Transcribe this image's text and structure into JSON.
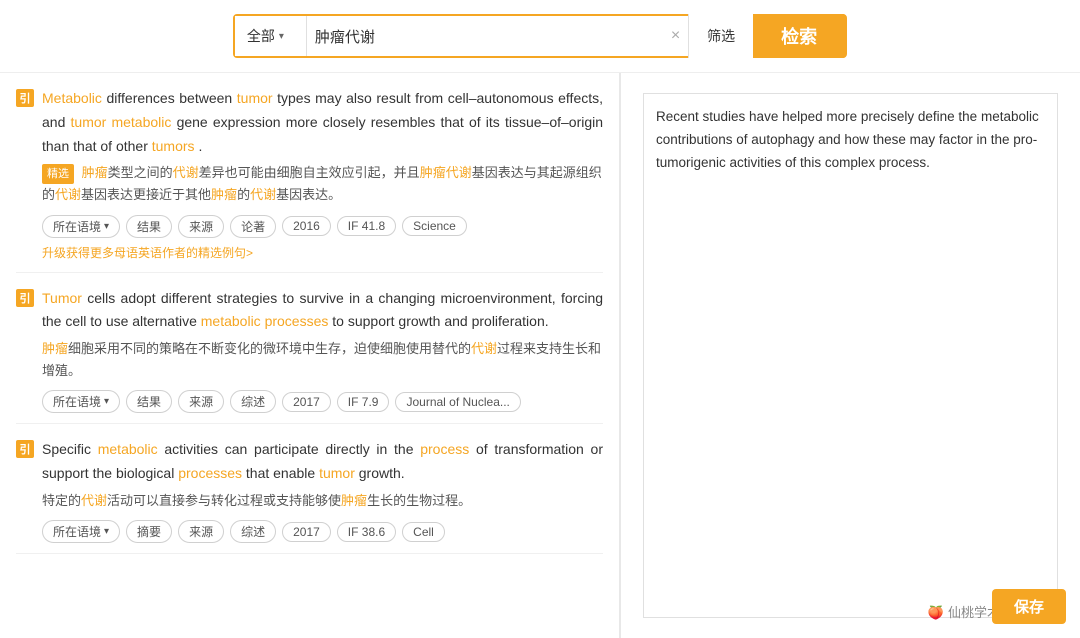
{
  "search": {
    "dropdown_label": "全部",
    "input_value": "肿瘤代谢",
    "filter_label": "筛选",
    "search_label": "检索",
    "clear_icon": "×"
  },
  "preview": {
    "text": "Recent studies have helped more precisely define the metabolic contributions of autophagy and how these may factor in the pro-tumorigenic activities of this complex process."
  },
  "results": [
    {
      "id": 1,
      "english_parts": [
        {
          "text": "Metabolic",
          "type": "orange"
        },
        {
          "text": " differences between ",
          "type": "normal"
        },
        {
          "text": "tumor",
          "type": "orange"
        },
        {
          "text": " types may also result from cell–autonomous effects, and ",
          "type": "normal"
        },
        {
          "text": "tumor metabolic",
          "type": "orange"
        },
        {
          "text": " gene expression more closely resembles that of its tissue–of–origin than that of other ",
          "type": "normal"
        },
        {
          "text": "tumors",
          "type": "orange"
        },
        {
          "text": ".",
          "type": "normal"
        }
      ],
      "chinese_badge": "精选",
      "chinese": "肿瘤类型之间的代谢差异也可能由细胞自主效应引起，并且肿瘤代谢基因表达与其起源组织的代谢基因表达更接近于其他肿瘤的代谢基因表达。",
      "chinese_highlights": [
        "肿瘤",
        "代谢",
        "肿瘤代谢",
        "代谢",
        "肿瘤",
        "代谢"
      ],
      "tags": [
        "所在语境",
        "结果",
        "来源",
        "论著",
        "2016",
        "IF 41.8",
        "Science"
      ],
      "upgrade_text": "升级获得更多母语英语作者的精选例句>"
    },
    {
      "id": 2,
      "english_parts": [
        {
          "text": "Tumor",
          "type": "orange"
        },
        {
          "text": " cells adopt different strategies to survive in a changing microenvironment, forcing the cell to use alternative ",
          "type": "normal"
        },
        {
          "text": "metabolic processes",
          "type": "orange"
        },
        {
          "text": " to support growth and proliferation.",
          "type": "normal"
        }
      ],
      "chinese_badge": null,
      "chinese": "肿瘤细胞采用不同的策略在不断变化的微环境中生存，迫使细胞使用替代的代谢过程来支持生长和增殖。",
      "chinese_highlights": [
        "肿瘤",
        "代谢"
      ],
      "tags": [
        "所在语境",
        "结果",
        "来源",
        "综述",
        "2017",
        "IF 7.9",
        "Journal of Nuclea..."
      ],
      "upgrade_text": null
    },
    {
      "id": 3,
      "english_parts": [
        {
          "text": "Specific ",
          "type": "normal"
        },
        {
          "text": "metabolic",
          "type": "orange"
        },
        {
          "text": " activities can participate directly in the ",
          "type": "normal"
        },
        {
          "text": "process",
          "type": "orange"
        },
        {
          "text": " of transformation or support the biological ",
          "type": "normal"
        },
        {
          "text": "processes",
          "type": "orange"
        },
        {
          "text": " that enable ",
          "type": "normal"
        },
        {
          "text": "tumor",
          "type": "orange"
        },
        {
          "text": " growth.",
          "type": "normal"
        }
      ],
      "chinese_badge": null,
      "chinese": "特定的代谢活动可以直接参与转化过程或支持能够使肿瘤生长的生物过程。",
      "chinese_highlights": [
        "代谢",
        "肿瘤"
      ],
      "tags": [
        "所在语境",
        "摘要",
        "来源",
        "综述",
        "2017",
        "IF 38.6",
        "Cell"
      ],
      "upgrade_text": null
    }
  ],
  "watermark": {
    "icon": "🍑",
    "text": "仙桃学术"
  },
  "save_button": "保存"
}
